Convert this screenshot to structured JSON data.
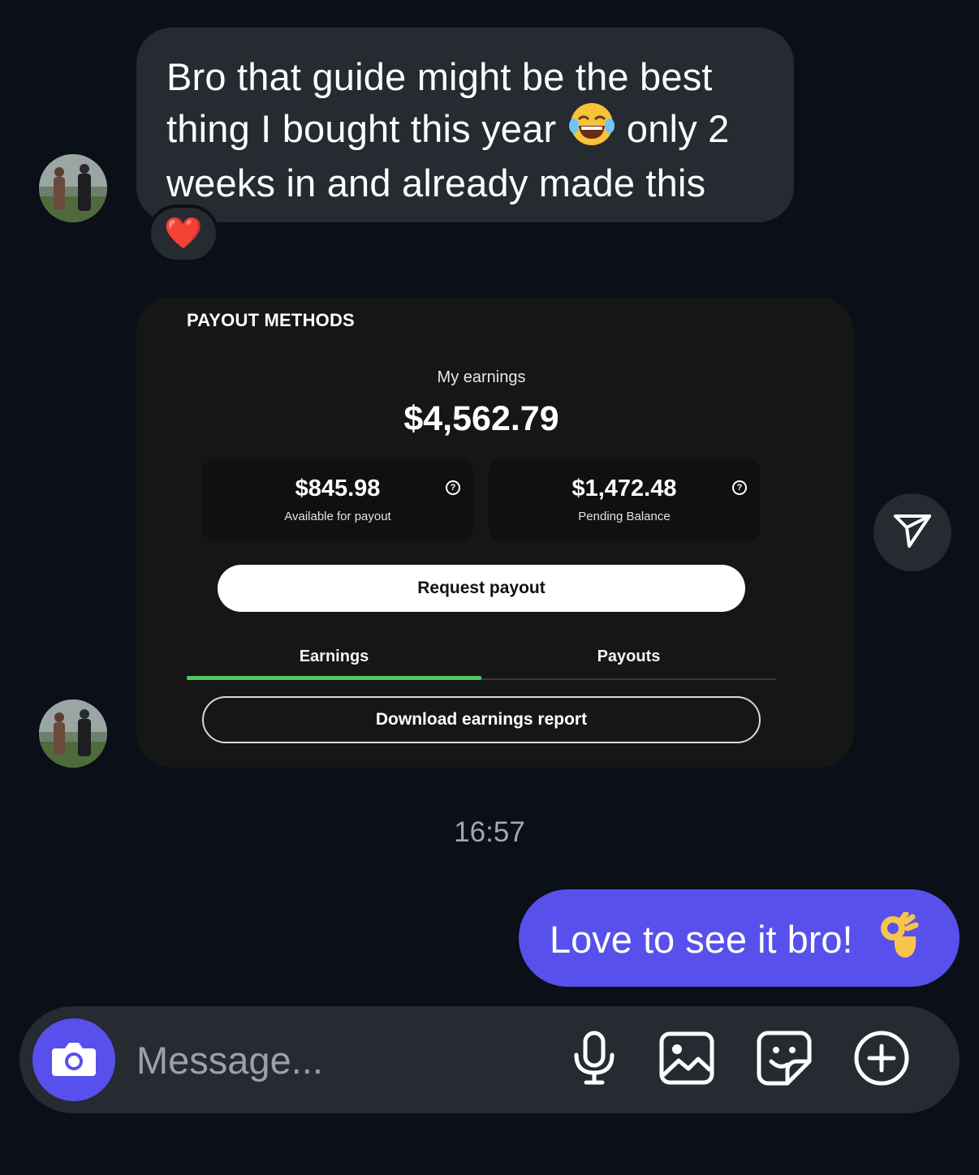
{
  "thread": {
    "incoming_text_1": "Bro that guide might be the best thing I bought this year",
    "incoming_text_2": "only 2 weeks in and already made this",
    "reaction": "❤️",
    "timestamp": "16:57",
    "outgoing_text": "Love to see it bro!"
  },
  "payout_card": {
    "title": "PAYOUT METHODS",
    "earnings_label": "My earnings",
    "earnings_value": "$4,562.79",
    "available_value": "$845.98",
    "available_label": "Available for payout",
    "pending_value": "$1,472.48",
    "pending_label": "Pending Balance",
    "help_symbol": "?",
    "request_button": "Request payout",
    "tabs": [
      "Earnings",
      "Payouts"
    ],
    "active_tab": "Earnings",
    "download_button": "Download earnings report",
    "accent": "#4ccc5c"
  },
  "composer": {
    "placeholder": "Message..."
  },
  "icons": {
    "send": "paper-plane-icon",
    "camera": "camera-icon",
    "mic": "microphone-icon",
    "gallery": "image-icon",
    "sticker": "sticker-icon",
    "more": "plus-circle-icon"
  },
  "colors": {
    "background": "#0b0f17",
    "incoming_bubble": "#262a31",
    "outgoing_bubble": "#5850ec"
  }
}
